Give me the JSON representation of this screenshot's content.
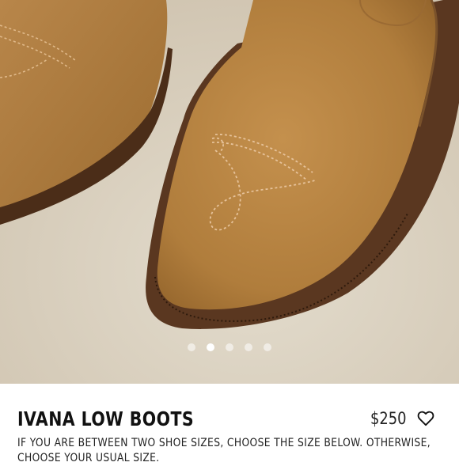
{
  "product": {
    "name": "IVANA LOW BOOTS",
    "price": "$250",
    "size_note": "IF YOU ARE BETWEEN TWO SHOE SIZES, CHOOSE THE SIZE BELOW. OTHERWISE, CHOOSE YOUR USUAL SIZE."
  },
  "gallery": {
    "image_count": 5,
    "active_index": 1
  },
  "colors": {
    "suede": "#b5823f",
    "sole": "#5a3720",
    "background": "#d9cfbf"
  },
  "icons": {
    "wishlist": "heart-outline-icon"
  }
}
